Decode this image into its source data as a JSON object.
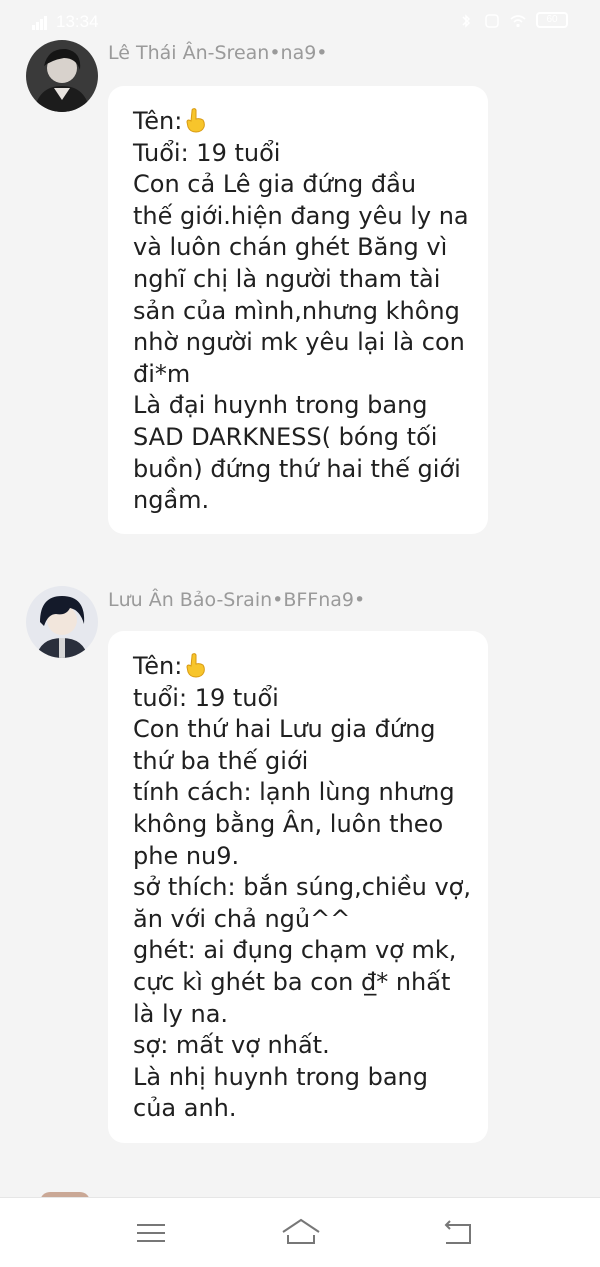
{
  "status_bar": {
    "time": "13:34",
    "battery": "60",
    "icons": [
      "signal-icon",
      "wifi-icon",
      "bluetooth-icon",
      "nfc-icon",
      "battery-icon"
    ]
  },
  "posts": [
    {
      "username": "Lê Thái Ân-Srean•na9•",
      "lines": [
        "Tên:",
        "Tuổi: 19 tuổi",
        "Con cả Lê gia đứng đầu",
        "thế giới.hiện đang yêu ly na",
        "và luôn chán ghét Băng vì",
        "nghĩ chị là người tham tài",
        "sản của mình,nhưng không",
        "nhờ người mk yêu lại là con",
        "đi*m",
        "Là đại huynh trong bang",
        "SAD DARKNESS( bóng tối",
        "buồn) đứng thứ hai thế giới",
        "ngầm."
      ]
    },
    {
      "username": "Lưu Ân Bảo-Srain•BFFna9•",
      "lines": [
        "Tên:",
        "tuổi: 19 tuổi",
        "Con thứ hai Lưu gia đứng",
        "thứ ba thế giới",
        "tính cách: lạnh lùng nhưng",
        "không bằng Ân, luôn theo",
        "phe nu9.",
        "sở thích: bắn súng,chiều vợ,",
        "ăn với chả ngủ^^",
        "ghét: ai đụng chạm vợ mk,",
        "cực kì ghét ba con đ̲* nhất",
        "là ly na.",
        "sợ: mất vợ nhất.",
        "Là nhị huynh trong bang",
        "của anh."
      ]
    }
  ],
  "nav": {
    "menu_icon": "menu-icon",
    "home_icon": "home-icon",
    "back_icon": "back-icon"
  }
}
